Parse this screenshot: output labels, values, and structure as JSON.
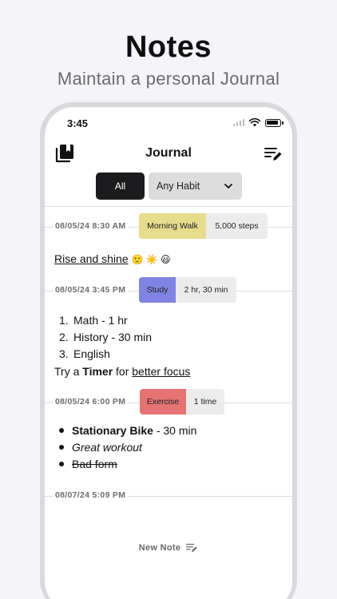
{
  "promo": {
    "title": "Notes",
    "subtitle": "Maintain a personal Journal"
  },
  "status_bar": {
    "time": "3:45"
  },
  "nav": {
    "title": "Journal",
    "left_icon": "journal-book-icon",
    "right_icon": "compose-note-icon"
  },
  "filters": {
    "all_label": "All",
    "habit_select": "Any Habit"
  },
  "entries": [
    {
      "date": "08/05/24 8:30 AM",
      "habit": "Morning Walk",
      "value": "5,000 steps",
      "color": "#e6dc8c",
      "note": {
        "link_text": "Rise and shine",
        "emojis": "🙂 ☀️ 😃"
      }
    },
    {
      "date": "08/05/24 3:45 PM",
      "habit": "Study",
      "value": "2 hr, 30 min",
      "color": "#7f83e3",
      "list": [
        "Math - 1 hr",
        "History - 30 min",
        "English"
      ],
      "list_markers": [
        "1.",
        "2.",
        "3."
      ],
      "tail": {
        "prefix": "Try a ",
        "bold": "Timer",
        "mid": " for ",
        "link": "better focus"
      }
    },
    {
      "date": "08/05/24 6:00 PM",
      "habit": "Exercise",
      "value": "1 time",
      "color": "#e57373",
      "bullets": [
        {
          "bold": "Stationary Bike",
          "rest": " - 30 min"
        },
        {
          "italic": "Great workout"
        },
        {
          "strike": "Bad form"
        }
      ]
    },
    {
      "date": "08/07/24 5:09 PM"
    }
  ],
  "new_note": {
    "label": "New Note",
    "icon": "compose-note-icon"
  }
}
